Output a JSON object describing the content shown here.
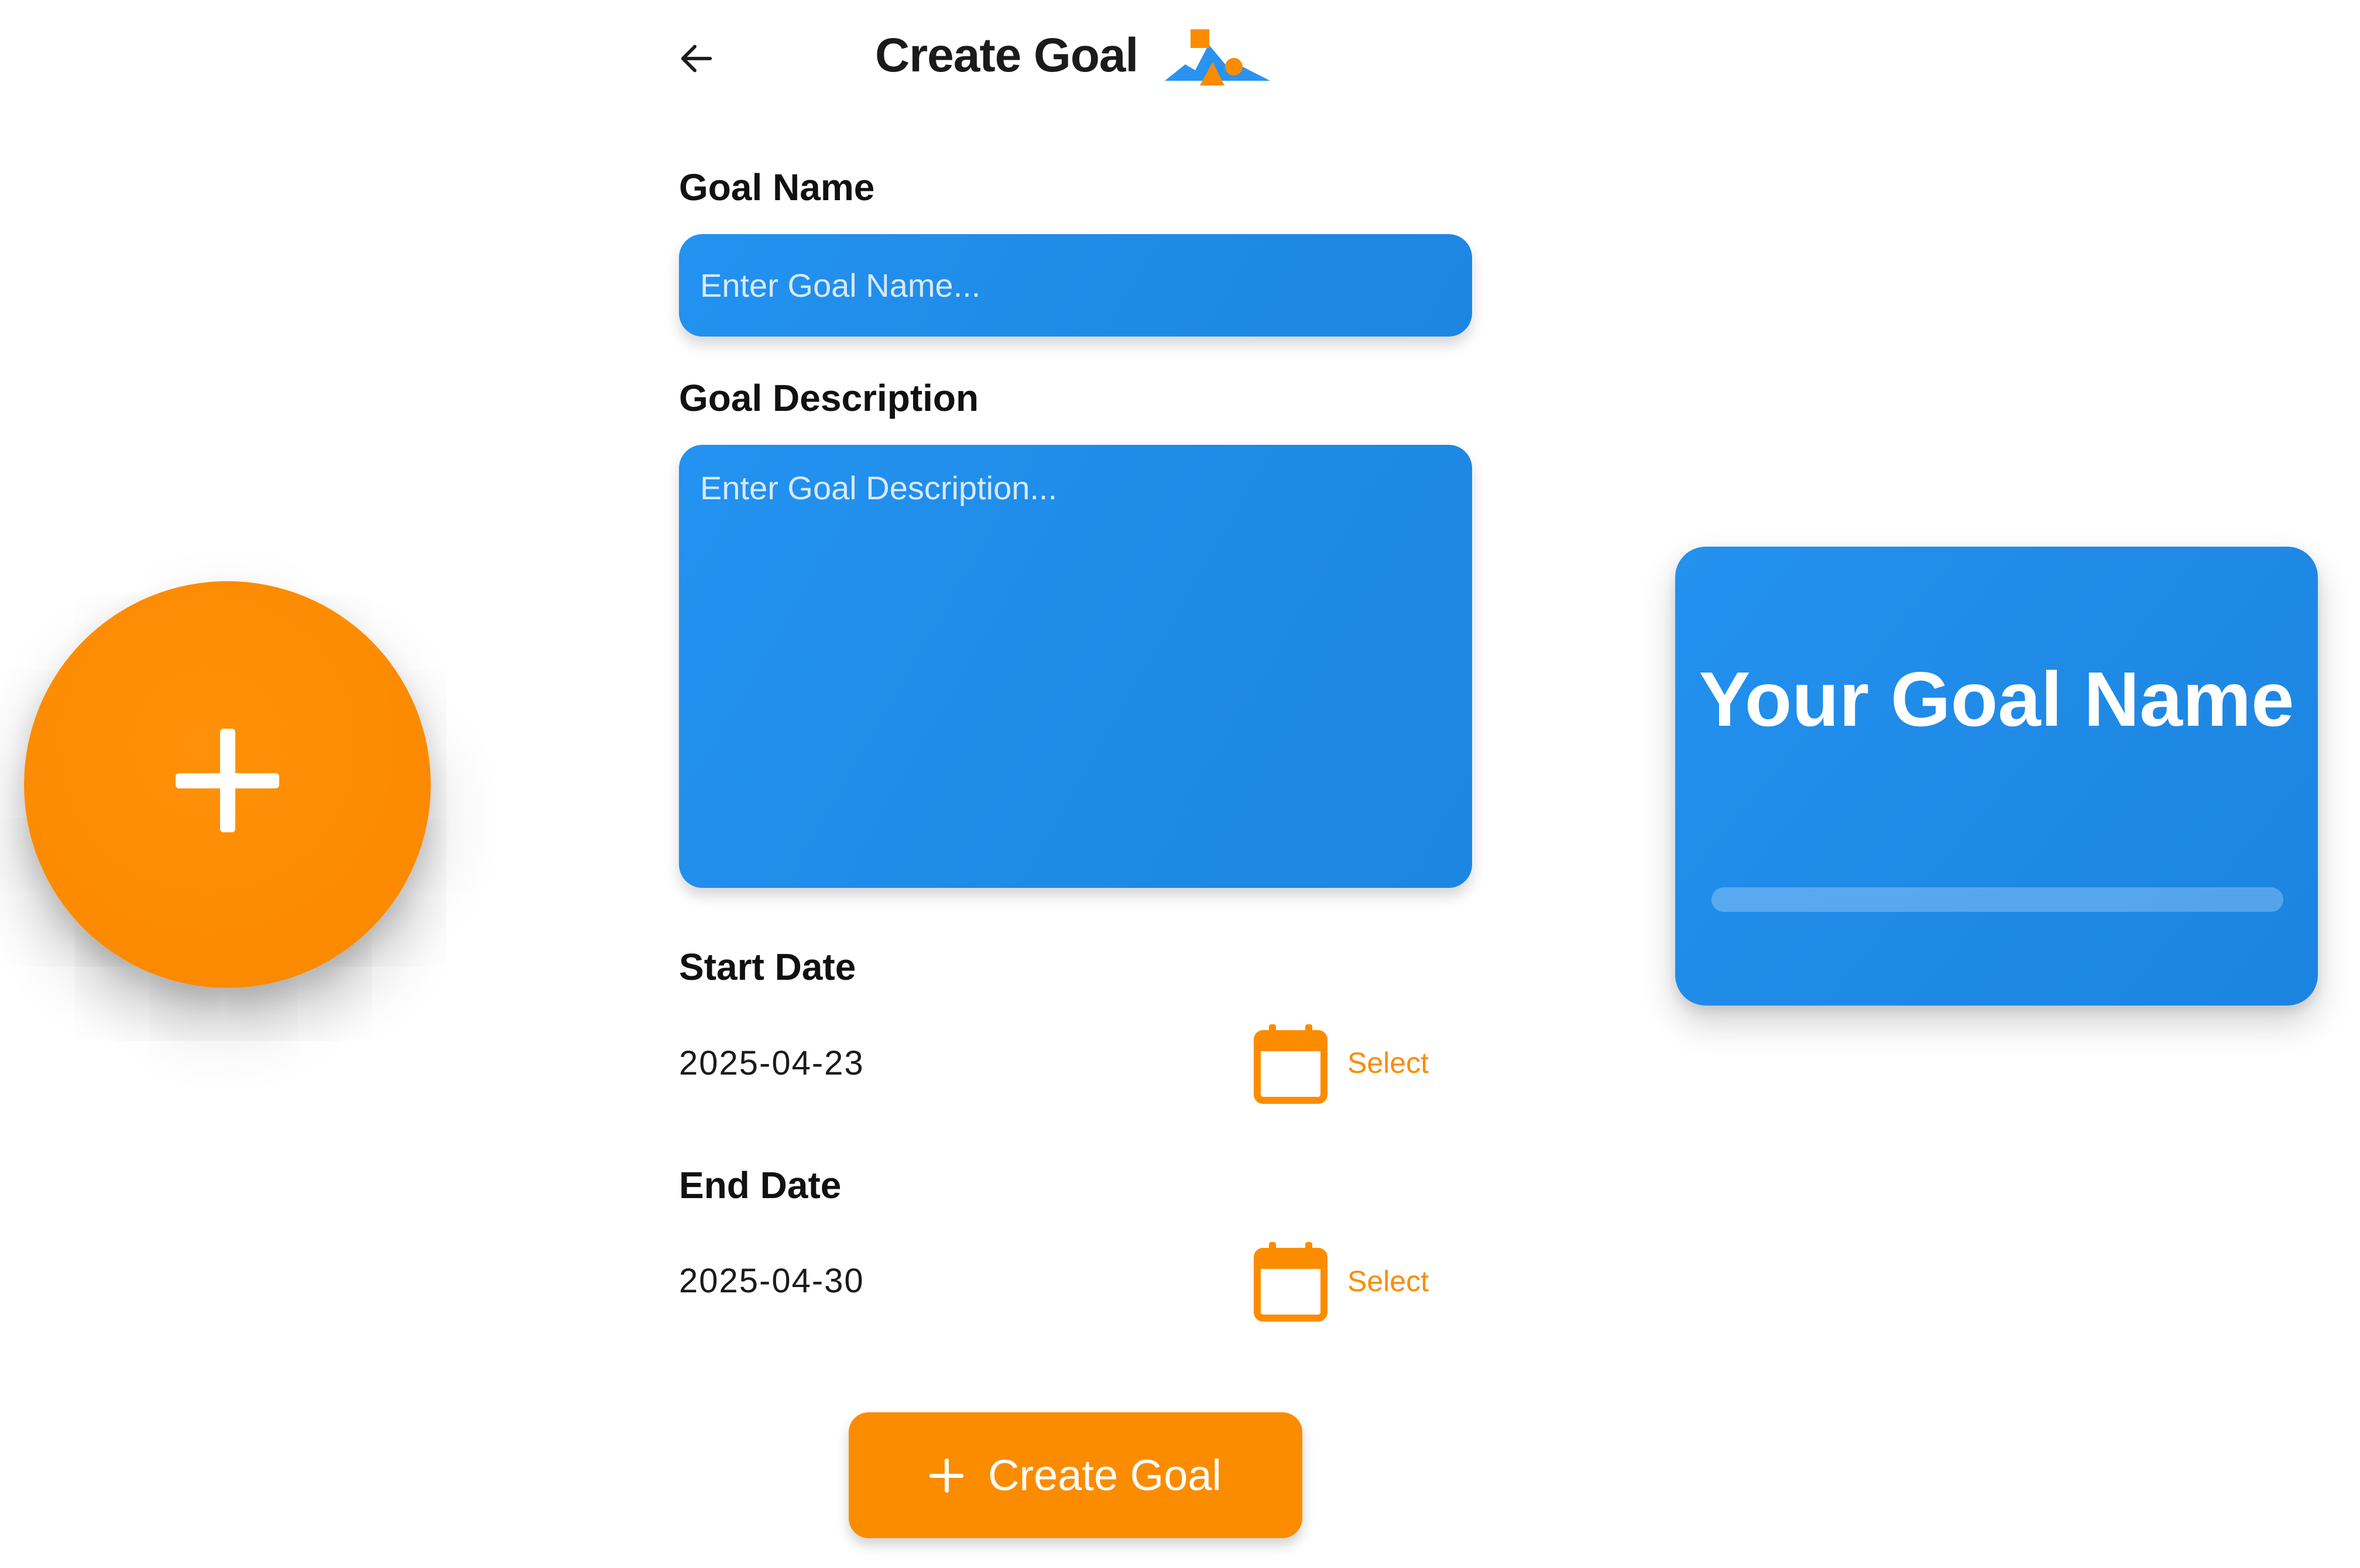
{
  "header": {
    "title": "Create Goal",
    "back_icon": "arrow-left-icon",
    "logo_icon": "mountain-shapes-logo-icon"
  },
  "form": {
    "goal_name": {
      "label": "Goal Name",
      "placeholder": "Enter Goal Name...",
      "value": ""
    },
    "goal_description": {
      "label": "Goal Description",
      "placeholder": "Enter Goal Description...",
      "value": ""
    },
    "start_date": {
      "label": "Start Date",
      "value": "2025-04-23",
      "select_label": "Select",
      "icon": "calendar-icon"
    },
    "end_date": {
      "label": "End Date",
      "value": "2025-04-30",
      "select_label": "Select",
      "icon": "calendar-icon"
    },
    "submit": {
      "label": "Create Goal",
      "icon": "plus-icon"
    }
  },
  "fab": {
    "icon": "plus-icon"
  },
  "preview": {
    "title": "Your Goal Name",
    "progress": 0
  },
  "colors": {
    "accent_orange": "#FB8C00",
    "primary_blue": "#1F8AE6",
    "text_dark": "#111111",
    "white": "#FFFFFF"
  }
}
